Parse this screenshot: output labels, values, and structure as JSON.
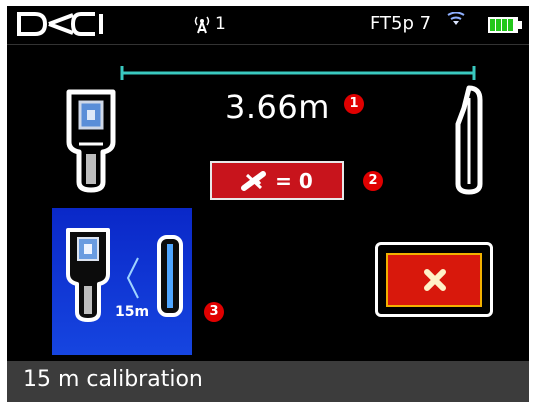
{
  "status_bar": {
    "logo_text": "DCI",
    "signal_icon": "antenna-icon",
    "signal_channel": "1",
    "frequency_label": "FT5p 7",
    "wifi_icon": "wifi-icon",
    "battery_icon": "battery-icon",
    "battery_level": 1.0
  },
  "main": {
    "distance_value": "3.66m",
    "pitch_label": "= 0",
    "calibration_distance": "15m"
  },
  "markers": [
    "1",
    "2",
    "3"
  ],
  "bottom_bar": {
    "label": "15 m calibration"
  },
  "colors": {
    "measure_line": "#3ac9c0",
    "marker_red": "#e00000",
    "pitch_button": "#c8141c",
    "calibration_button": "#1645e0",
    "cancel_button": "#d8180c",
    "cancel_border": "#f2b000",
    "battery": "#22c71a"
  }
}
